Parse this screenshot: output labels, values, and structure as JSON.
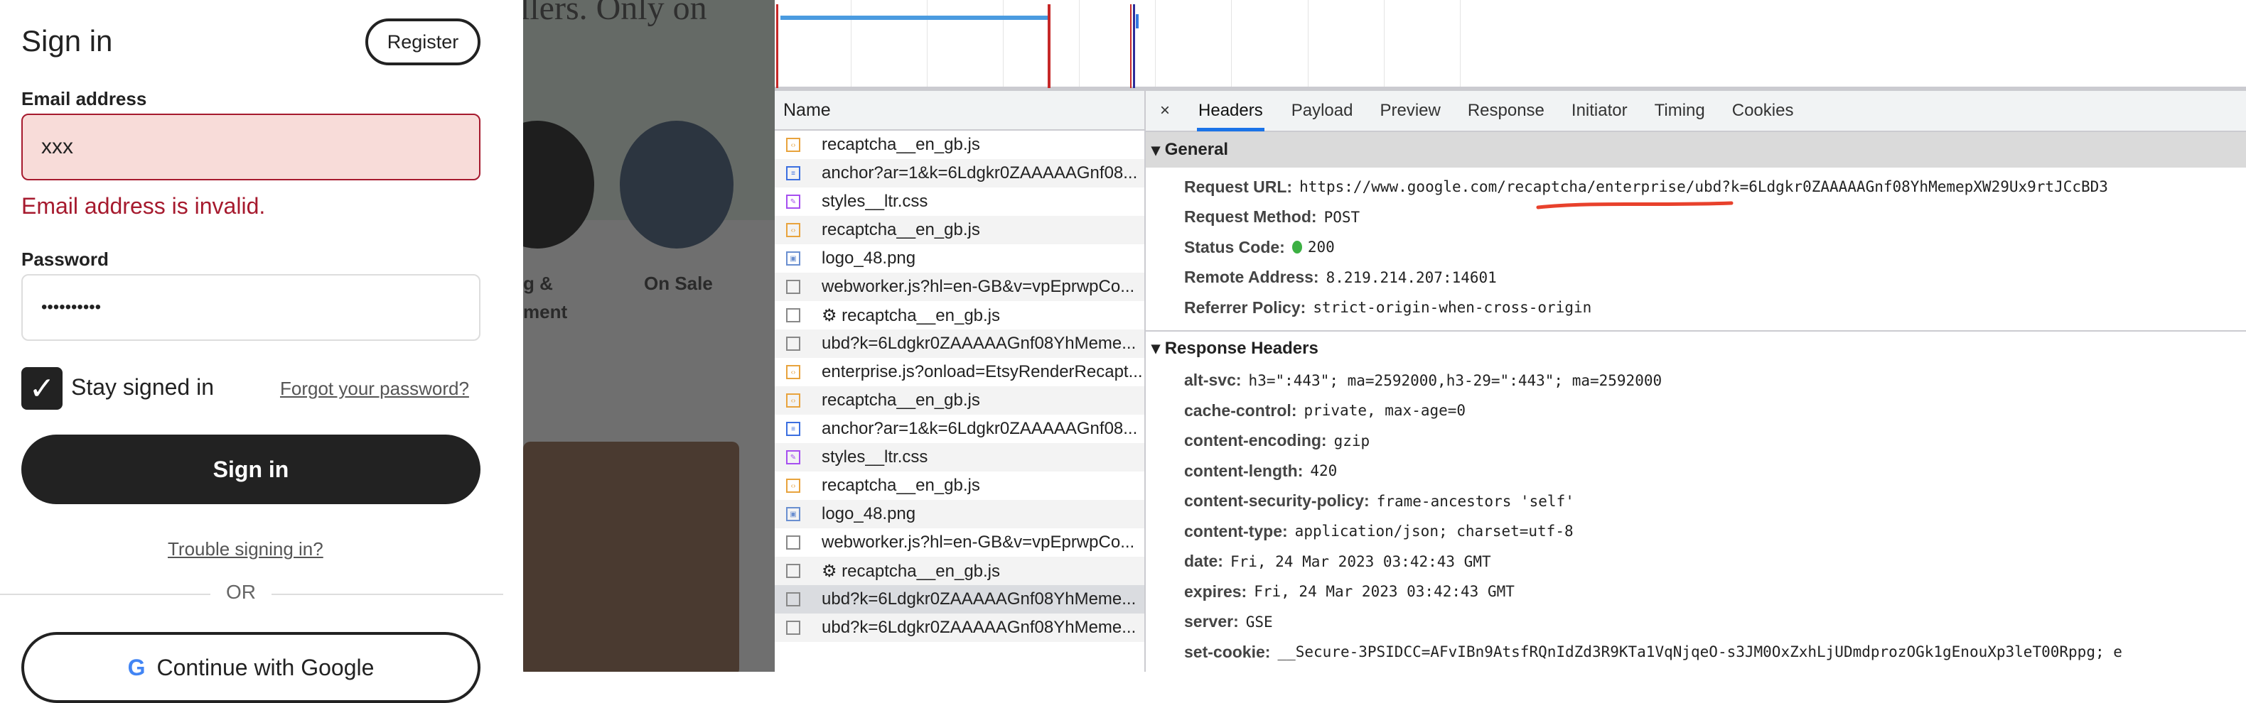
{
  "signin": {
    "title": "Sign in",
    "register": "Register",
    "email_label": "Email address",
    "email_value": "xxx",
    "email_error": "Email address is invalid.",
    "password_label": "Password",
    "password_value": "••••••••••",
    "stay_signed_in": "Stay signed in",
    "stay_checked": true,
    "forgot": "Forgot your password?",
    "signin_button": "Sign in",
    "trouble": "Trouble signing in?",
    "or": "OR",
    "google": "Continue with Google"
  },
  "background": {
    "heading_fragment": "llers. Only on",
    "category_partial_1": "g &",
    "category_partial_2": "ment",
    "category_on_sale": "On Sale"
  },
  "network": {
    "name_header": "Name",
    "requests": [
      {
        "name": "recaptcha__en_gb.js",
        "type": "script"
      },
      {
        "name": "anchor?ar=1&k=6Ldgkr0ZAAAAAGnf08...",
        "type": "document"
      },
      {
        "name": "styles__ltr.css",
        "type": "stylesheet"
      },
      {
        "name": "recaptcha__en_gb.js",
        "type": "script"
      },
      {
        "name": "logo_48.png",
        "type": "image"
      },
      {
        "name": "webworker.js?hl=en-GB&v=vpEprwpCo...",
        "type": "other"
      },
      {
        "name": "⚙ recaptcha__en_gb.js",
        "type": "other"
      },
      {
        "name": "ubd?k=6Ldgkr0ZAAAAAGnf08YhMeme...",
        "type": "other"
      },
      {
        "name": "enterprise.js?onload=EtsyRenderRecapt...",
        "type": "script"
      },
      {
        "name": "recaptcha__en_gb.js",
        "type": "script"
      },
      {
        "name": "anchor?ar=1&k=6Ldgkr0ZAAAAAGnf08...",
        "type": "document"
      },
      {
        "name": "styles__ltr.css",
        "type": "stylesheet"
      },
      {
        "name": "recaptcha__en_gb.js",
        "type": "script"
      },
      {
        "name": "logo_48.png",
        "type": "image"
      },
      {
        "name": "webworker.js?hl=en-GB&v=vpEprwpCo...",
        "type": "other"
      },
      {
        "name": "⚙ recaptcha__en_gb.js",
        "type": "other"
      },
      {
        "name": "ubd?k=6Ldgkr0ZAAAAAGnf08YhMeme...",
        "type": "other",
        "selected": true
      },
      {
        "name": "ubd?k=6Ldgkr0ZAAAAAGnf08YhMeme...",
        "type": "other"
      }
    ]
  },
  "details": {
    "close": "×",
    "tabs": [
      "Headers",
      "Payload",
      "Preview",
      "Response",
      "Initiator",
      "Timing",
      "Cookies"
    ],
    "active_tab": "Headers",
    "general_title": "General",
    "general": [
      {
        "k": "Request URL:",
        "v": "https://www.google.com/recaptcha/enterprise/ubd?k=6Ldgkr0ZAAAAAGnf08YhMemepXW29Ux9rtJCcBD3"
      },
      {
        "k": "Request Method:",
        "v": "POST"
      },
      {
        "k": "Status Code:",
        "v": "200"
      },
      {
        "k": "Remote Address:",
        "v": "8.219.214.207:14601"
      },
      {
        "k": "Referrer Policy:",
        "v": "strict-origin-when-cross-origin"
      }
    ],
    "response_title": "Response Headers",
    "response": [
      {
        "k": "alt-svc:",
        "v": "h3=\":443\"; ma=2592000,h3-29=\":443\"; ma=2592000"
      },
      {
        "k": "cache-control:",
        "v": "private, max-age=0"
      },
      {
        "k": "content-encoding:",
        "v": "gzip"
      },
      {
        "k": "content-length:",
        "v": "420"
      },
      {
        "k": "content-security-policy:",
        "v": "frame-ancestors 'self'"
      },
      {
        "k": "content-type:",
        "v": "application/json; charset=utf-8"
      },
      {
        "k": "date:",
        "v": "Fri, 24 Mar 2023 03:42:43 GMT"
      },
      {
        "k": "expires:",
        "v": "Fri, 24 Mar 2023 03:42:43 GMT"
      },
      {
        "k": "server:",
        "v": "GSE"
      },
      {
        "k": "set-cookie:",
        "v": "__Secure-3PSIDCC=AFvIBn9AtsfRQnIdZd3R9KTa1VqNjqeO-s3JM0OxZxhLjUDmdprozOGk1gEnouXp3leT00Rppg; e"
      }
    ]
  },
  "colors": {
    "error": "#a61a2e",
    "error_bg": "#f8dcd9",
    "accent": "#1a73e8",
    "annotation": "#e8412c"
  }
}
